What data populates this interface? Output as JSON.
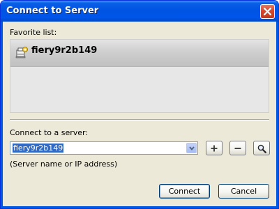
{
  "window": {
    "title": "Connect to Server"
  },
  "favorites": {
    "label": "Favorite list:",
    "items": [
      {
        "name": "fiery9r2b149",
        "icon": "printer-server-icon"
      }
    ]
  },
  "server": {
    "label": "Connect to a server:",
    "value": "fiery9r2b149",
    "hint": "(Server name or IP address)"
  },
  "toolbar": {
    "add": "+",
    "remove": "−"
  },
  "buttons": {
    "connect": "Connect",
    "cancel": "Cancel"
  },
  "colors": {
    "titlebar": "#0054e3",
    "dialog_bg": "#ece9d8",
    "selection": "#316ac5",
    "close_button": "#d6482b"
  }
}
